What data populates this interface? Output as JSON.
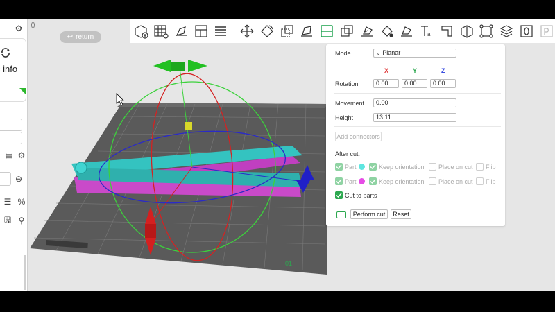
{
  "sidebar": {
    "card_label": "c info",
    "top_icon": "gear-icon",
    "row_icons": [
      "plate-icon",
      "gear-icon"
    ],
    "minus_icon": "circle-minus-icon",
    "list_icon": "list-icon",
    "percent_icon": "percent-icon",
    "save_icon": "save-icon",
    "search_icon": "search-icon"
  },
  "viewport": {
    "return_label": "return",
    "return_icon": "return-arrow-icon",
    "collapse_icon": "collapse-panel-icon",
    "plate_text": "01"
  },
  "toolbar": {
    "icons": [
      "add-icon",
      "arrange-grid-icon",
      "orient-icon",
      "layout-icon",
      "layers-icon",
      "move-icon",
      "rotate-icon",
      "scale-icon",
      "lay-on-face-icon",
      "cut-icon",
      "boolean-icon",
      "support-paint-icon",
      "seam-paint-icon",
      "color-paint-icon",
      "text-icon",
      "measure-icon",
      "assembly-icon",
      "view-icon",
      "more-icon"
    ]
  },
  "cut_panel": {
    "mode_label": "Mode",
    "mode_value": "Planar",
    "axes": [
      {
        "label": "X",
        "color": "#e03c3c"
      },
      {
        "label": "Y",
        "color": "#2ca84f"
      },
      {
        "label": "Z",
        "color": "#3b4fe0"
      }
    ],
    "rotation_label": "Rotation",
    "rotation_values": [
      "0.00",
      "0.00",
      "0.00"
    ],
    "movement_label": "Movement",
    "movement_value": "0.00",
    "height_label": "Height",
    "height_value": "13.11",
    "add_connectors_label": "Add connectors",
    "after_cut_label": "After cut:",
    "parts": [
      {
        "part_label": "Part",
        "dot_color": "#5ee6e0",
        "keep_label": "Keep orientation",
        "place_label": "Place on cut",
        "flip_label": "Flip"
      },
      {
        "part_label": "Part",
        "dot_color": "#e64ce6",
        "keep_label": "Keep orientation",
        "place_label": "Place on cut",
        "flip_label": "Flip"
      }
    ],
    "cut_to_parts_label": "Cut to parts",
    "keyboard_icon": "keyboard-icon",
    "perform_cut_label": "Perform cut",
    "reset_label": "Reset"
  }
}
